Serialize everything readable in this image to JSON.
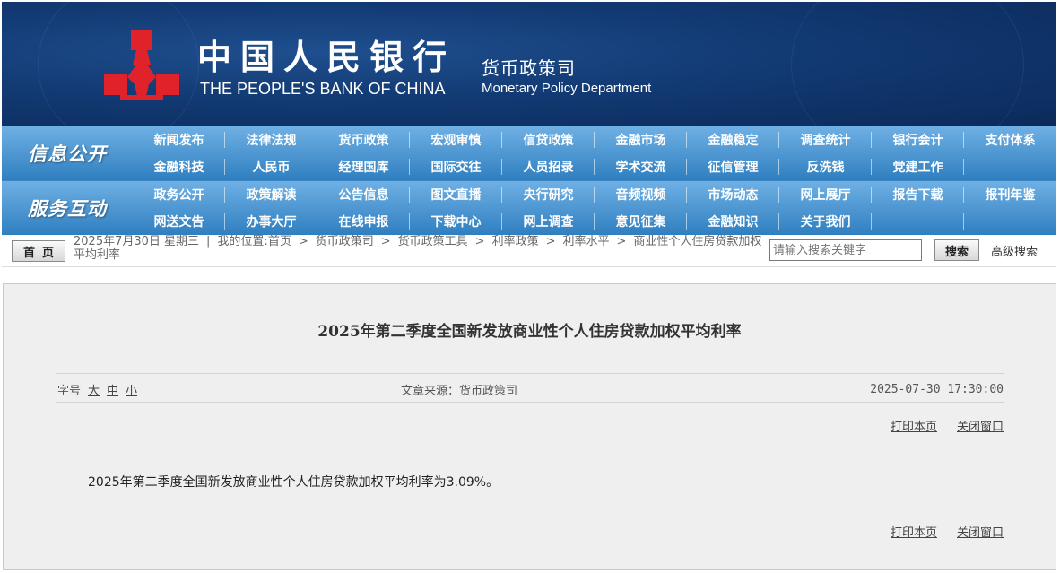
{
  "header": {
    "org_cn": "中国人民银行",
    "org_en": "THE PEOPLE'S BANK OF CHINA",
    "dept_cn": "货币政策司",
    "dept_en": "Monetary Policy Department",
    "logo_icon": "pboc-logo-icon",
    "colors": {
      "banner": "#123a73",
      "logo": "#e0222a",
      "nav": "#3b87c6"
    }
  },
  "nav": {
    "section1_title": "信息公开",
    "section1_row1": [
      "新闻发布",
      "法律法规",
      "货币政策",
      "宏观审慎",
      "信贷政策",
      "金融市场",
      "金融稳定",
      "调查统计",
      "银行会计",
      "支付体系"
    ],
    "section1_row2": [
      "金融科技",
      "人民币",
      "经理国库",
      "国际交往",
      "人员招录",
      "学术交流",
      "征信管理",
      "反洗钱",
      "党建工作",
      ""
    ],
    "section2_title": "服务互动",
    "section2_row1": [
      "政务公开",
      "政策解读",
      "公告信息",
      "图文直播",
      "央行研究",
      "音频视频",
      "市场动态",
      "网上展厅",
      "报告下载",
      "报刊年鉴"
    ],
    "section2_row2": [
      "网送文告",
      "办事大厅",
      "在线申报",
      "下载中心",
      "网上调查",
      "意见征集",
      "金融知识",
      "关于我们",
      "",
      ""
    ]
  },
  "breadcrumb": {
    "home_label": "首页",
    "date": "2025年7月30日 星期三",
    "location_prefix": "我的位置:",
    "items": [
      "首页",
      "货币政策司",
      "货币政策工具",
      "利率政策",
      "利率水平",
      "商业性个人住房贷款加权平均利率"
    ]
  },
  "search": {
    "placeholder": "请输入搜索关键字",
    "button_label": "搜索",
    "advanced_label": "高级搜索"
  },
  "article": {
    "title": "2025年第二季度全国新发放商业性个人住房贷款加权平均利率",
    "fontsize_label": "字号",
    "fontsize_options": [
      "大",
      "中",
      "小"
    ],
    "source": "文章来源：货币政策司",
    "date": "2025-07-30 17:30:00",
    "print_label": "打印本页",
    "close_label": "关闭窗口",
    "body": "2025年第二季度全国新发放商业性个人住房贷款加权平均利率为3.09%。"
  }
}
